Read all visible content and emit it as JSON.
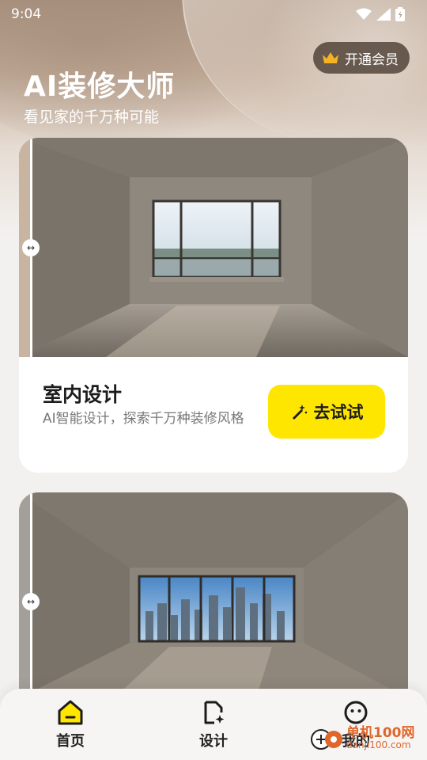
{
  "status_bar": {
    "time": "9:04"
  },
  "header": {
    "vip_label": "开通会员",
    "title": "AI装修大师",
    "subtitle": "看见家的千万种可能"
  },
  "cards": [
    {
      "title": "室内设计",
      "description": "AI智能设计，探索千万种装修风格",
      "button_label": "去试试"
    },
    {
      "title": "",
      "description": "",
      "button_label": ""
    }
  ],
  "tabbar": {
    "items": [
      {
        "label": "首页",
        "icon": "home-icon",
        "active": true
      },
      {
        "label": "设计",
        "icon": "design-icon",
        "active": false
      },
      {
        "label": "我的",
        "icon": "profile-icon",
        "active": false
      }
    ]
  },
  "watermark": {
    "line1": "单机100网",
    "line2": "danji100.com"
  },
  "colors": {
    "accent": "#ffe600",
    "text": "#1c1c1c",
    "muted": "#777777"
  }
}
